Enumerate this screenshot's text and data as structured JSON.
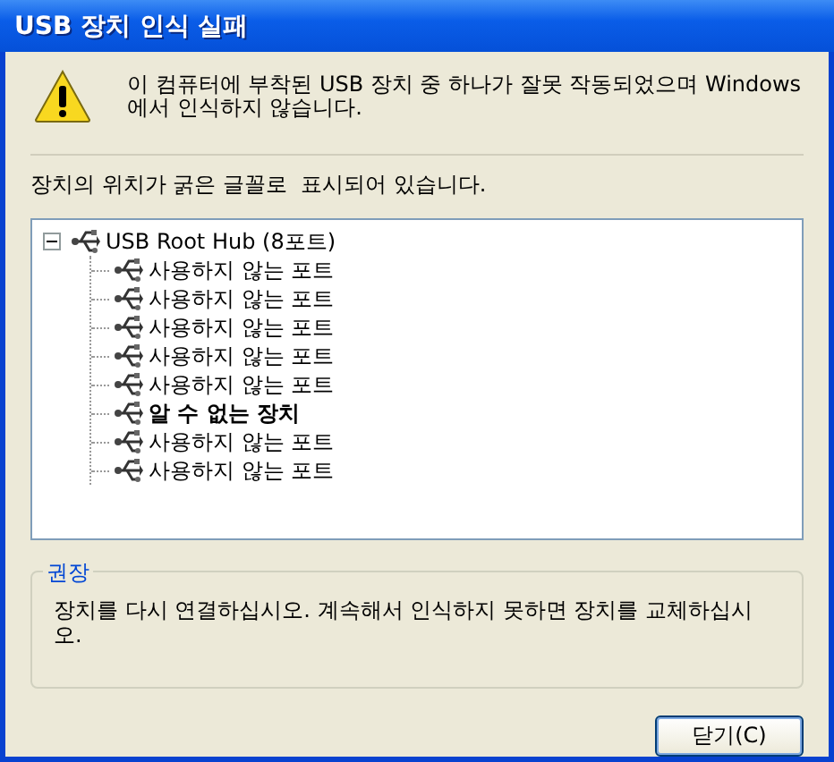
{
  "window": {
    "title": "USB 장치 인식 실패"
  },
  "message": "이 컴퓨터에 부착된 USB 장치 중 하나가 잘못 작동되었으며 Windows 에서 인식하지 않습니다.",
  "legend": "장치의 위치가 굵은 글꼴로  표시되어 있습니다.",
  "tree": {
    "label": "USB Root Hub (8포트)",
    "expanded": true,
    "children": [
      {
        "label": "사용하지 않는 포트",
        "bold": false
      },
      {
        "label": "사용하지 않는 포트",
        "bold": false
      },
      {
        "label": "사용하지 않는 포트",
        "bold": false
      },
      {
        "label": "사용하지 않는 포트",
        "bold": false
      },
      {
        "label": "사용하지 않는 포트",
        "bold": false
      },
      {
        "label": "알 수 없는 장치",
        "bold": true
      },
      {
        "label": "사용하지 않는 포트",
        "bold": false
      },
      {
        "label": "사용하지 않는 포트",
        "bold": false
      }
    ]
  },
  "recommendation": {
    "title": "권장",
    "text": "장치를 다시 연결하십시오. 계속해서 인식하지 못하면 장치를 교체하십시오."
  },
  "buttons": [
    "닫기(C)"
  ]
}
